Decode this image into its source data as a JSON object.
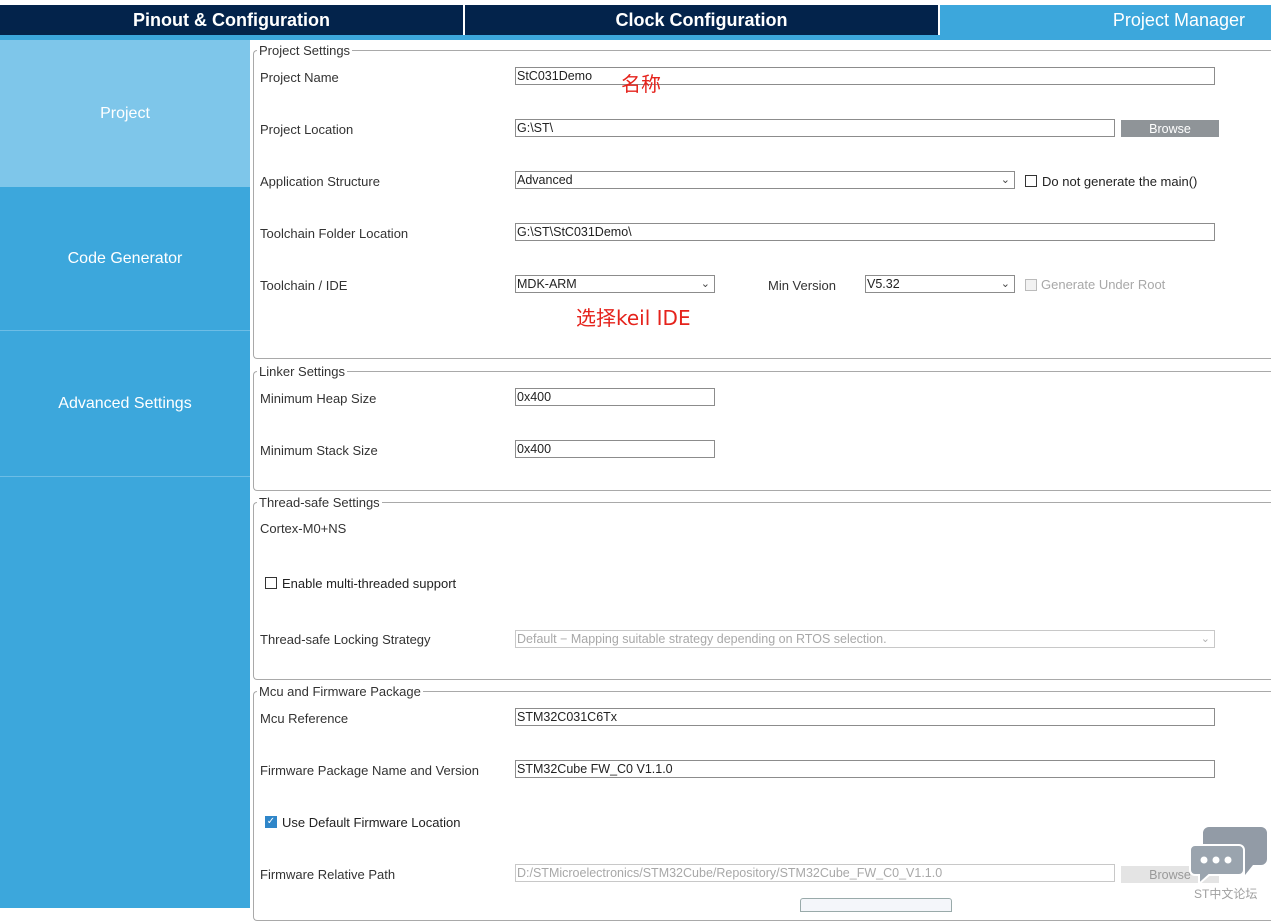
{
  "tabs": [
    {
      "label": "Pinout & Configuration"
    },
    {
      "label": "Clock Configuration"
    },
    {
      "label": "Project Manager"
    }
  ],
  "sidebar": {
    "items": [
      {
        "label": "Project",
        "active": true
      },
      {
        "label": "Code Generator",
        "active": false
      },
      {
        "label": "Advanced Settings",
        "active": false
      }
    ]
  },
  "project_settings": {
    "legend": "Project Settings",
    "project_name": {
      "label": "Project Name",
      "value": "StC031Demo"
    },
    "project_location": {
      "label": "Project Location",
      "value": "G:\\ST\\",
      "browse": "Browse"
    },
    "application_structure": {
      "label": "Application Structure",
      "value": "Advanced",
      "checkbox_label": "Do not generate the main()",
      "checked": false
    },
    "toolchain_folder": {
      "label": "Toolchain Folder Location",
      "value": "G:\\ST\\StC031Demo\\"
    },
    "toolchain_ide": {
      "label": "Toolchain / IDE",
      "value": "MDK-ARM",
      "min_version_label": "Min Version",
      "min_version_value": "V5.32",
      "generate_under_root": "Generate Under Root"
    },
    "annotation_name": "名称",
    "annotation_ide": "选择keil IDE"
  },
  "linker_settings": {
    "legend": "Linker Settings",
    "heap": {
      "label": "Minimum Heap Size",
      "value": "0x400"
    },
    "stack": {
      "label": "Minimum Stack Size",
      "value": "0x400"
    }
  },
  "thread_safe": {
    "legend": "Thread-safe Settings",
    "core": "Cortex-M0+NS",
    "multithread_label": "Enable multi-threaded support",
    "multithread_checked": false,
    "locking_label": "Thread-safe Locking Strategy",
    "locking_value": "Default  −  Mapping suitable strategy depending on RTOS selection."
  },
  "mcu_firmware": {
    "legend": "Mcu and Firmware Package",
    "mcu_ref": {
      "label": "Mcu Reference",
      "value": "STM32C031C6Tx"
    },
    "fw_name": {
      "label": "Firmware Package Name and Version",
      "value": "STM32Cube FW_C0 V1.1.0"
    },
    "use_default": {
      "label": "Use Default Firmware Location",
      "checked": true
    },
    "fw_path": {
      "label": "Firmware Relative Path",
      "value": "D:/STMicroelectronics/STM32Cube/Repository/STM32Cube_FW_C0_V1.1.0",
      "browse": "Browse"
    }
  },
  "watermark": "ST中文论坛",
  "colors": {
    "navy": "#03234b",
    "accent": "#3ca7dc",
    "active_sidebar": "#7ec6ea",
    "annotation_red": "#e5231c"
  }
}
